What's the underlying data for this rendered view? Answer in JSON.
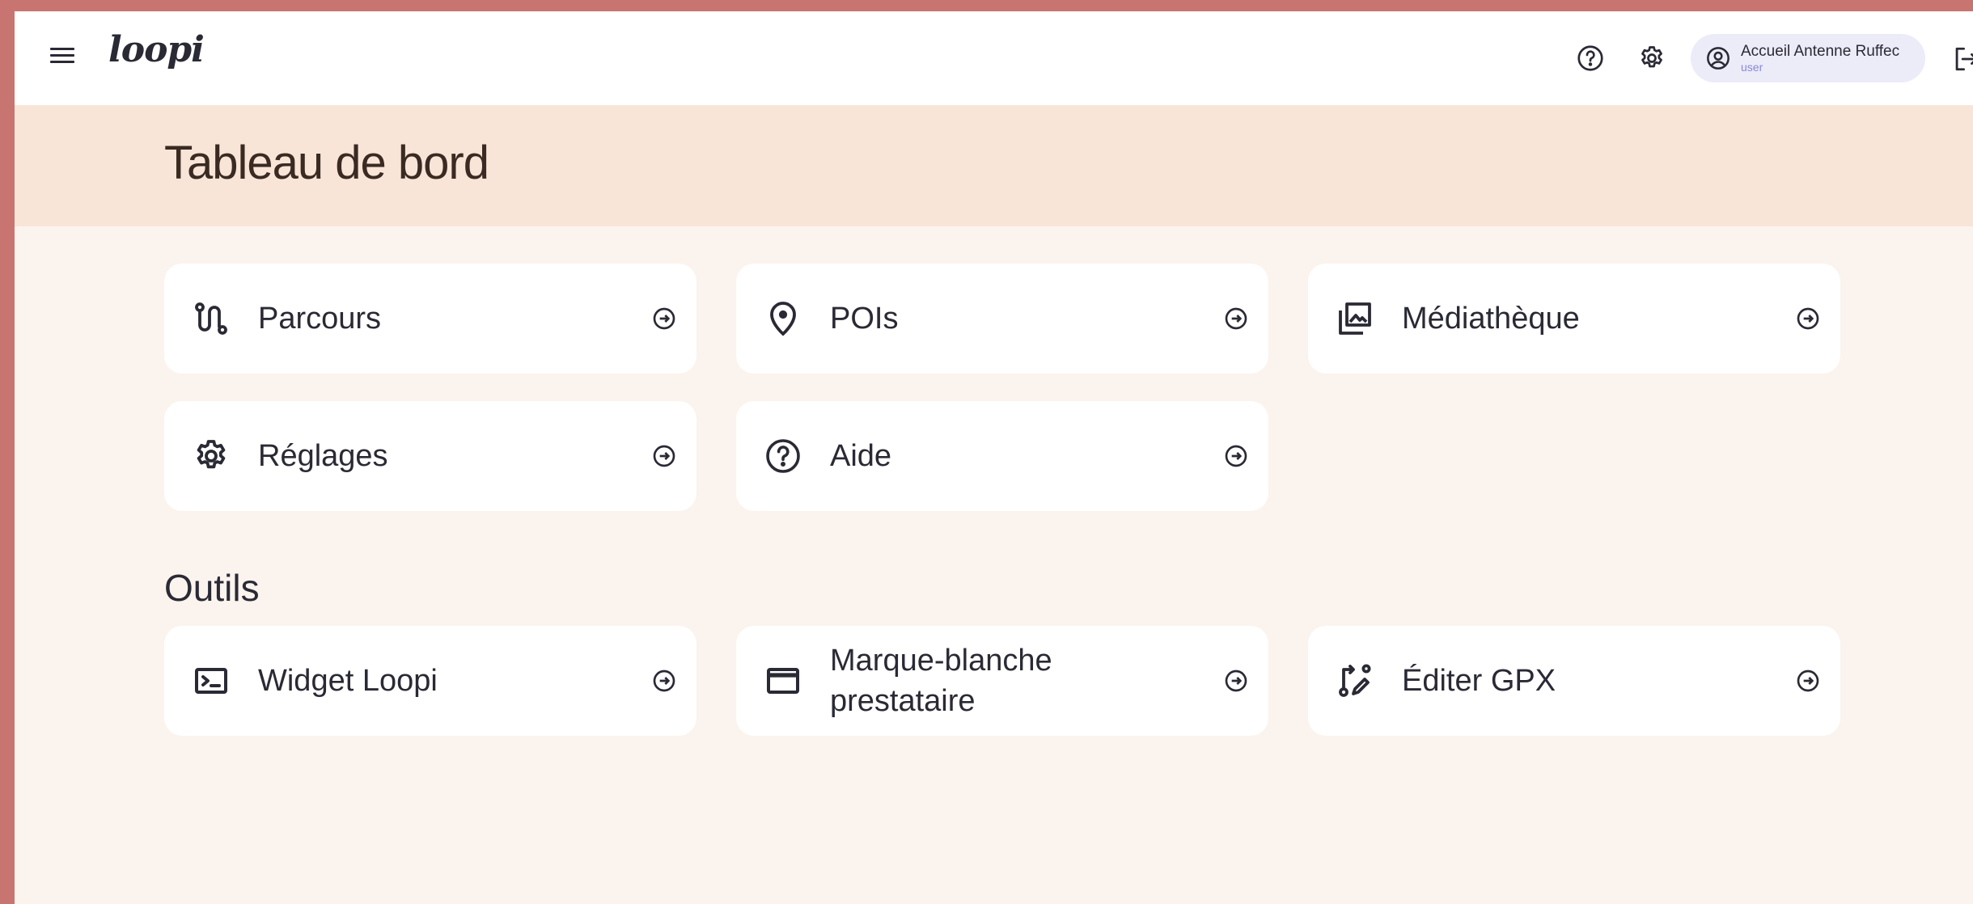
{
  "app": {
    "logo": "loopi"
  },
  "topbar": {
    "user_name": "Accueil Antenne Ruffec",
    "user_role": "user"
  },
  "page": {
    "title": "Tableau de bord"
  },
  "main_cards": [
    {
      "label": "Parcours",
      "icon": "route-icon"
    },
    {
      "label": "POIs",
      "icon": "map-pin-icon"
    },
    {
      "label": "Médiathèque",
      "icon": "photo-library-icon"
    },
    {
      "label": "Réglages",
      "icon": "gear-icon"
    },
    {
      "label": "Aide",
      "icon": "help-circle-icon"
    }
  ],
  "tools": {
    "title": "Outils",
    "cards": [
      {
        "label": "Widget Loopi",
        "icon": "terminal-icon"
      },
      {
        "label": "Marque-blanche prestataire",
        "icon": "browser-window-icon"
      },
      {
        "label": "Éditer GPX",
        "icon": "route-edit-icon"
      }
    ]
  },
  "colors": {
    "outer_background": "#c87571",
    "page_background": "#fbf3ed",
    "header_band": "#f8e5d8",
    "user_pill": "#ecebf8",
    "user_role_text": "#8b87d8",
    "text_dark": "#2a2a35"
  }
}
